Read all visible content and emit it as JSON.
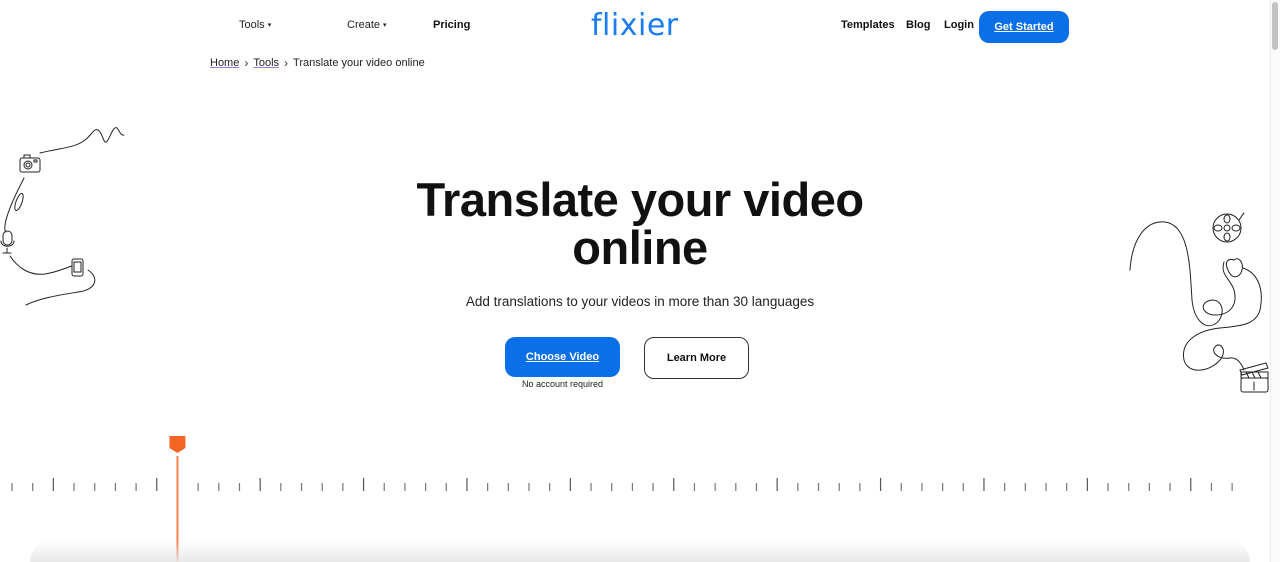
{
  "nav": {
    "left": [
      {
        "label": "Tools",
        "has_dropdown": true
      },
      {
        "label": "Create",
        "has_dropdown": true
      },
      {
        "label": "Pricing",
        "has_dropdown": false
      }
    ],
    "caret": "▾",
    "logo": "flixier",
    "right": [
      {
        "label": "Templates"
      },
      {
        "label": "Blog"
      },
      {
        "label": "Login"
      }
    ],
    "cta_label": "Get Started"
  },
  "breadcrumb": {
    "items": [
      "Home",
      "Tools"
    ],
    "current": "Translate your video online",
    "separator": "›"
  },
  "hero": {
    "title_line1": "Translate your video",
    "title_line2": "online",
    "subtitle": "Add translations to your videos in more than 30 languages",
    "primary_button": "Choose Video",
    "primary_note": "No account required",
    "secondary_button": "Learn More"
  },
  "timeline": {
    "playhead_color": "#f26522",
    "tick_count": 60,
    "major_every": 5,
    "playhead_position_ticks": 8
  },
  "colors": {
    "brand": "#1a7cf0",
    "button": "#0b6fe8",
    "playhead": "#f26522"
  },
  "doodles": {
    "left": [
      "camera-icon",
      "microphone-icon",
      "phone-icon"
    ],
    "right": [
      "film-reel-icon",
      "clapperboard-icon"
    ]
  }
}
